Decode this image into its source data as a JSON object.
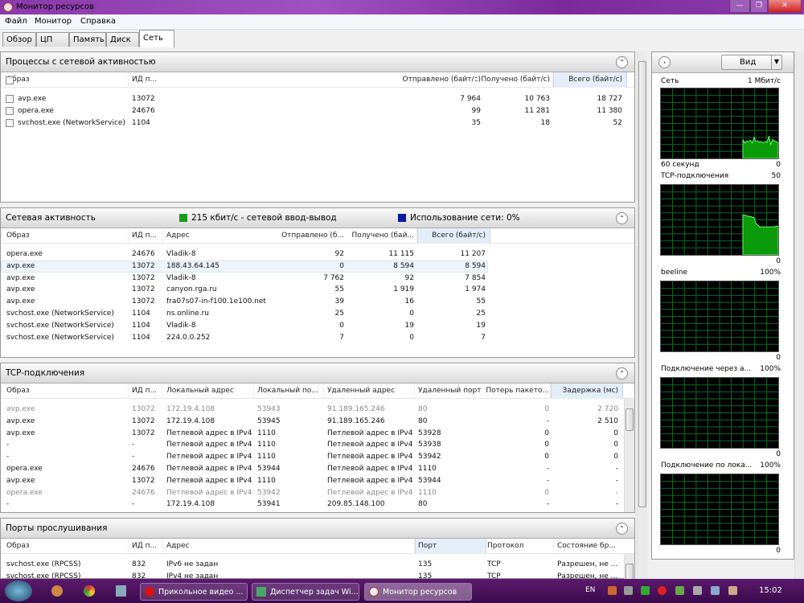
{
  "window": {
    "title": "Монитор ресурсов",
    "minimize": "—",
    "maximize": "❐",
    "close": "✕"
  },
  "menu": [
    "Файл",
    "Монитор",
    "Справка"
  ],
  "tabs": [
    "Обзор",
    "ЦП",
    "Память",
    "Диск",
    "Сеть"
  ],
  "selected_tab": "Сеть",
  "processes": {
    "title": "Процессы с сетевой активностью",
    "columns": [
      "Образ",
      "ИД п...",
      "Отправлено (байт/с)",
      "Получено (байт/с)",
      "Всего (байт/с)"
    ],
    "rows": [
      [
        "avp.exe",
        "13072",
        "7 964",
        "10 763",
        "18 727"
      ],
      [
        "opera.exe",
        "24676",
        "99",
        "11 281",
        "11 380"
      ],
      [
        "svchost.exe (NetworkService)",
        "1104",
        "35",
        "18",
        "52"
      ]
    ]
  },
  "network": {
    "title": "Сетевая активность",
    "io_label": "215 кбит/с - сетевой ввод-вывод",
    "usage_label": "Использование сети: 0%",
    "io_color": "#1a9a1a",
    "usage_color": "#0a1aa0",
    "columns": [
      "Образ",
      "ИД п...",
      "Адрес",
      "Отправлено (б...",
      "Получено (бай...",
      "Всего (байт/с)"
    ],
    "rows": [
      [
        "opera.exe",
        "24676",
        "Vladik-8",
        "92",
        "11 115",
        "11 207"
      ],
      [
        "avp.exe",
        "13072",
        "188.43.64.145",
        "0",
        "8 594",
        "8 594"
      ],
      [
        "avp.exe",
        "13072",
        "Vladik-8",
        "7 762",
        "92",
        "7 854"
      ],
      [
        "avp.exe",
        "13072",
        "canyon.rga.ru",
        "55",
        "1 919",
        "1 974"
      ],
      [
        "avp.exe",
        "13072",
        "fra07s07-in-f100.1e100.net",
        "39",
        "16",
        "55"
      ],
      [
        "svchost.exe (NetworkService)",
        "1104",
        "ns.online.ru",
        "25",
        "0",
        "25"
      ],
      [
        "svchost.exe (NetworkService)",
        "1104",
        "Vladik-8",
        "0",
        "19",
        "19"
      ],
      [
        "svchost.exe (NetworkService)",
        "1104",
        "224.0.0.252",
        "7",
        "0",
        "7"
      ]
    ]
  },
  "tcp": {
    "title": "TCP-подключения",
    "columns": [
      "Образ",
      "ИД п...",
      "Локальный адрес",
      "Локальный по...",
      "Удаленный адрес",
      "Удаленный порт",
      "Потерь пакето...",
      "Задержка (мс)"
    ],
    "rows": [
      [
        "avp.exe",
        "13072",
        "172.19.4.108",
        "53943",
        "91.189.165.246",
        "80",
        "0",
        "2 720"
      ],
      [
        "avp.exe",
        "13072",
        "172.19.4.108",
        "53945",
        "91.189.165.246",
        "80",
        "-",
        "2 510"
      ],
      [
        "avp.exe",
        "13072",
        "Петлевой адрес в IPv4",
        "1110",
        "Петлевой адрес в IPv4",
        "53928",
        "0",
        "0"
      ],
      [
        "-",
        "-",
        "Петлевой адрес в IPv4",
        "1110",
        "Петлевой адрес в IPv4",
        "53938",
        "0",
        "0"
      ],
      [
        "-",
        "-",
        "Петлевой адрес в IPv4",
        "1110",
        "Петлевой адрес в IPv4",
        "53942",
        "0",
        "0"
      ],
      [
        "opera.exe",
        "24676",
        "Петлевой адрес в IPv4",
        "53944",
        "Петлевой адрес в IPv4",
        "1110",
        "-",
        "-"
      ],
      [
        "avp.exe",
        "13072",
        "Петлевой адрес в IPv4",
        "1110",
        "Петлевой адрес в IPv4",
        "53944",
        "-",
        "-"
      ],
      [
        "opera.exe",
        "24676",
        "Петлевой адрес в IPv4",
        "53942",
        "Петлевой адрес в IPv4",
        "1110",
        "0",
        "-"
      ],
      [
        "-",
        "-",
        "172.19.4.108",
        "53941",
        "209.85.148.100",
        "80",
        "-",
        "-"
      ]
    ],
    "dimmed_rows": [
      0,
      7
    ]
  },
  "ports": {
    "title": "Порты прослушивания",
    "columns": [
      "Образ",
      "ИД п...",
      "Адрес",
      "Порт",
      "Протокол",
      "Состояние бр..."
    ],
    "rows": [
      [
        "svchost.exe (RPCSS)",
        "832",
        "IPv6 не задан",
        "135",
        "TCP",
        "Разрешен, не ..."
      ],
      [
        "svchost.exe (RPCSS)",
        "832",
        "IPv4 не задан",
        "135",
        "TCP",
        "Разрешен, не ..."
      ]
    ]
  },
  "right": {
    "view_label": "Вид",
    "graphs": [
      {
        "title": "Сеть",
        "max": "1 Мбит/с",
        "bottom_left": "60 секунд",
        "min": "0",
        "history": [
          0,
          0,
          0,
          0,
          0,
          0,
          0,
          0,
          0,
          0,
          0,
          0,
          0,
          0,
          0,
          0,
          0,
          0,
          0,
          0,
          0,
          0,
          0,
          0,
          0,
          0,
          0,
          0,
          0,
          0,
          0,
          0,
          0,
          0,
          0,
          0,
          0,
          0,
          0,
          0,
          0,
          0,
          0,
          0,
          27,
          22,
          25,
          24,
          26,
          22,
          30,
          24,
          25,
          23,
          24,
          22,
          24,
          23,
          32,
          20,
          27,
          25,
          24,
          22
        ]
      },
      {
        "title": "TCP-подключения",
        "max": "50",
        "bottom_left": "",
        "min": "0",
        "history": [
          0,
          0,
          0,
          0,
          0,
          0,
          0,
          0,
          0,
          0,
          0,
          0,
          0,
          0,
          0,
          0,
          0,
          0,
          0,
          0,
          0,
          0,
          0,
          0,
          0,
          0,
          0,
          0,
          0,
          0,
          0,
          0,
          0,
          0,
          0,
          0,
          0,
          0,
          0,
          0,
          0,
          0,
          0,
          0,
          57,
          57,
          56,
          55,
          55,
          54,
          53,
          45,
          43,
          40,
          40,
          40,
          40,
          40,
          40,
          40,
          40,
          40,
          41,
          41
        ]
      },
      {
        "title": "beeline",
        "max": "100%",
        "bottom_left": "",
        "min": "0",
        "history": []
      },
      {
        "title": "Подключение через а...",
        "max": "100%",
        "bottom_left": "",
        "min": "0",
        "history": []
      },
      {
        "title": "Подключение по лока...",
        "max": "100%",
        "bottom_left": "",
        "min": "0",
        "history": []
      }
    ]
  },
  "taskbar": {
    "items": [
      "Прикольное видео ...",
      "Диспетчер задач Wi...",
      "Монитор ресурсов"
    ],
    "active": "Монитор ресурсов",
    "lang": "EN",
    "clock": "15:02"
  }
}
